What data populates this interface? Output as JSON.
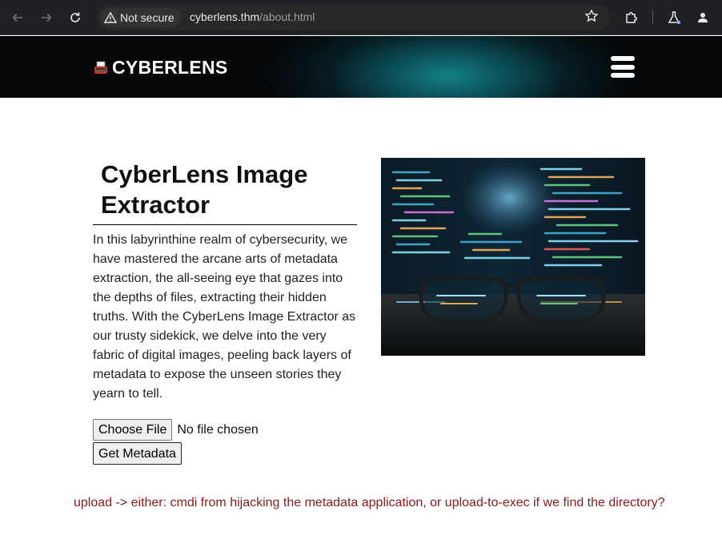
{
  "browser": {
    "security_label": "Not secure",
    "url_host": "cyberlens.thm",
    "url_path": "/about.html"
  },
  "site": {
    "brand": "CYBERLENS",
    "brand_icon": "typewriter-icon",
    "menu_icon": "hamburger-menu-icon"
  },
  "main": {
    "title": "CyberLens Image Extractor",
    "description": "In this labyrinthine realm of cybersecurity, we have mastered the arcane arts of metadata extraction, the all-seeing eye that gazes into the depths of files, extracting their hidden truths. With the CyberLens Image Extractor as our trusty sidekick, we delve into the very fabric of digital images, peeling back layers of metadata to expose the unseen stories they yearn to tell.",
    "choose_file_label": "Choose File",
    "no_file_label": "No file chosen",
    "submit_label": "Get Metadata",
    "image_subject": "glasses in front of code monitor"
  },
  "annotation": {
    "note": "upload -> either: cmdi from hijacking the metadata application, or upload-to-exec if we find the directory?"
  },
  "colors": {
    "chrome_bg": "#202124",
    "header_accent": "#137f87",
    "note_color": "#8b1a1a"
  }
}
